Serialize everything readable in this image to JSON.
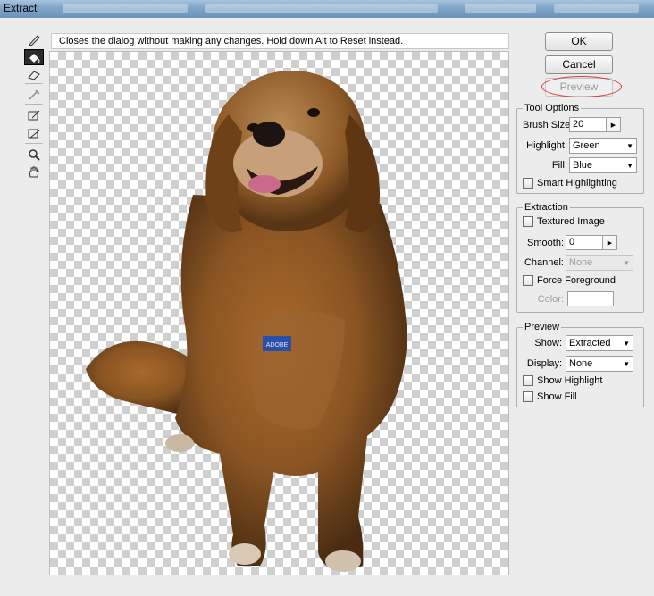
{
  "window": {
    "title": "Extract"
  },
  "hint": "Closes the dialog without making any changes. Hold down Alt to Reset instead.",
  "toolbox": {
    "tools": [
      "edge-highlighter-icon",
      "fill-icon",
      "eraser-icon",
      "eyedropper-icon",
      "cleanup-icon",
      "edge-touchup-icon",
      "zoom-icon",
      "hand-icon"
    ],
    "active": "fill-icon"
  },
  "buttons": {
    "ok": "OK",
    "cancel": "Cancel",
    "preview": "Preview"
  },
  "tool_options": {
    "title": "Tool Options",
    "brush_size_label": "Brush Size:",
    "brush_size_value": "20",
    "highlight_label": "Highlight:",
    "highlight_value": "Green",
    "fill_label": "Fill:",
    "fill_value": "Blue",
    "smart_highlighting_label": "Smart Highlighting"
  },
  "extraction": {
    "title": "Extraction",
    "textured_image_label": "Textured Image",
    "smooth_label": "Smooth:",
    "smooth_value": "0",
    "channel_label": "Channel:",
    "channel_value": "None",
    "force_foreground_label": "Force Foreground",
    "color_label": "Color:"
  },
  "preview": {
    "title": "Preview",
    "show_label": "Show:",
    "show_value": "Extracted",
    "display_label": "Display:",
    "display_value": "None",
    "show_highlight_label": "Show Highlight",
    "show_fill_label": "Show Fill"
  },
  "canvas": {
    "tag_text": "ADOBE"
  },
  "colors": {
    "highlight_ring": "#d33a3a",
    "tag_blue": "#2b4ea8",
    "fur": "#8a5523"
  }
}
